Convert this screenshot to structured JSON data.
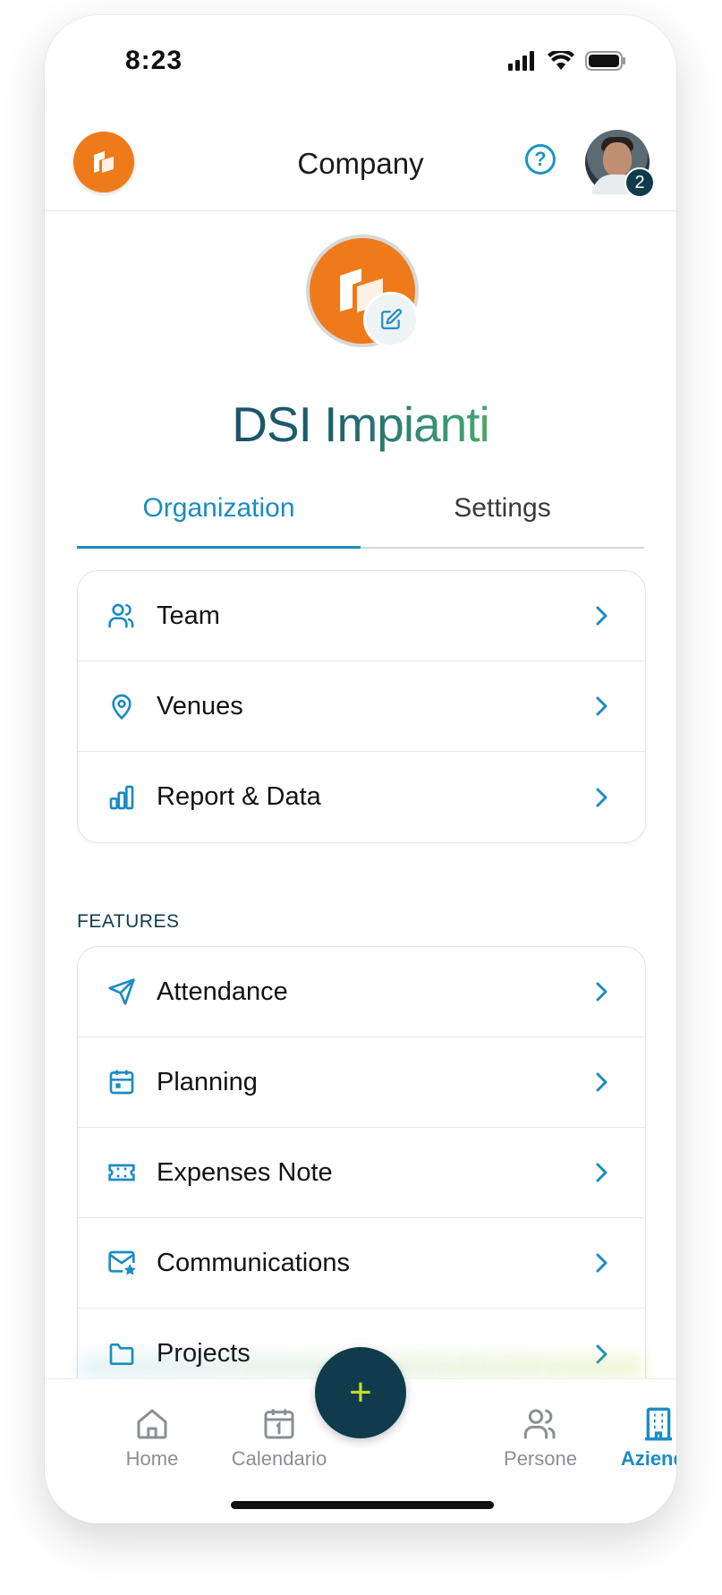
{
  "status_bar": {
    "time": "8:23"
  },
  "header": {
    "title": "Company",
    "help_glyph": "?",
    "notification_count": "2"
  },
  "company": {
    "name": "DSI Impianti"
  },
  "tabs": [
    {
      "label": "Organization",
      "active": true
    },
    {
      "label": "Settings",
      "active": false
    }
  ],
  "organization_items": [
    {
      "label": "Team",
      "icon": "users-icon"
    },
    {
      "label": "Venues",
      "icon": "map-pin-icon"
    },
    {
      "label": "Report & Data",
      "icon": "bar-chart-icon"
    }
  ],
  "features": {
    "section_label": "FEATURES",
    "items": [
      {
        "label": "Attendance",
        "icon": "send-icon"
      },
      {
        "label": "Planning",
        "icon": "calendar-icon"
      },
      {
        "label": "Expenses Note",
        "icon": "ticket-icon"
      },
      {
        "label": "Communications",
        "icon": "mail-star-icon"
      },
      {
        "label": "Projects",
        "icon": "folder-icon"
      }
    ]
  },
  "tabbar": {
    "items": [
      {
        "label": "Home",
        "icon": "home-icon",
        "active": false
      },
      {
        "label": "Calendario",
        "icon": "calendar-icon",
        "active": false
      },
      {
        "label": "Persone",
        "icon": "users-icon",
        "active": false
      },
      {
        "label": "Azienda",
        "icon": "building-icon",
        "active": true
      }
    ],
    "fab_glyph": "+"
  },
  "colors": {
    "brand_orange": "#ef7a1a",
    "accent_blue": "#1a8cc4",
    "dark_teal": "#0f3b4d",
    "lime": "#c6dc2e"
  }
}
